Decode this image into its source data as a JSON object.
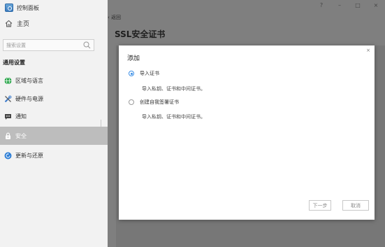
{
  "app": {
    "title": "控制面板"
  },
  "sidebar": {
    "home_label": "主页",
    "search_placeholder": "搜索设置",
    "section_title": "通用设置",
    "items": [
      {
        "label": "区域与语言",
        "icon": "globe-icon"
      },
      {
        "label": "硬件与电源",
        "icon": "tools-icon"
      },
      {
        "label": "通知",
        "icon": "chat-bubble-icon"
      },
      {
        "label": "安全",
        "icon": "lock-icon",
        "active": true
      },
      {
        "label": "更新与还原",
        "icon": "refresh-icon"
      }
    ]
  },
  "window": {
    "help": "?",
    "minimize": "–",
    "maximize": "□",
    "close": "×"
  },
  "main": {
    "back_label": "返回",
    "page_title": "SSL安全证书"
  },
  "dialog": {
    "title": "添加",
    "close": "×",
    "options": [
      {
        "label": "导入证书",
        "description": "导入私钥、证书和中间证书。",
        "checked": true
      },
      {
        "label": "创建自我签署证书",
        "description": "导入私钥、证书和中间证书。",
        "checked": false
      }
    ],
    "next_button": "下一步",
    "cancel_button": "取消"
  },
  "colors": {
    "accent": "#3a8ee6",
    "active_nav": "#bdbdbd",
    "overlay": "#7f7f7f"
  }
}
